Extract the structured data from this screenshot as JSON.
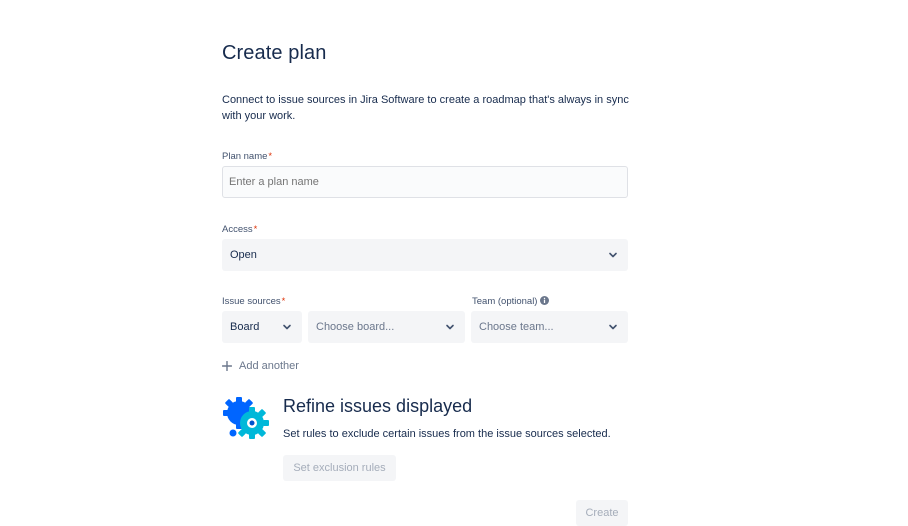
{
  "form": {
    "title": "Create plan",
    "description": "Connect to issue sources in Jira Software to create a roadmap that's always in sync with your work.",
    "plan_name": {
      "label": "Plan name",
      "required_mark": "*",
      "value": "",
      "placeholder": "Enter a plan name"
    },
    "access": {
      "label": "Access",
      "required_mark": "*",
      "value": "Open"
    },
    "issue_sources": {
      "label": "Issue sources",
      "required_mark": "*",
      "type_value": "Board",
      "board_placeholder": "Choose board..."
    },
    "team": {
      "label": "Team (optional)",
      "placeholder": "Choose team...",
      "info_icon": "info-icon"
    },
    "add_another_label": "Add another",
    "refine": {
      "title": "Refine issues displayed",
      "description": "Set rules to exclude certain issues from the issue sources selected.",
      "button_label": "Set exclusion rules",
      "icon": "gear-icon"
    },
    "create_label": "Create"
  },
  "colors": {
    "text": "#172b4d",
    "required": "#de350b",
    "disabled_text": "#a5adba",
    "field_bg": "#f4f5f7",
    "brand_blue": "#0065ff",
    "brand_cyan": "#00b8d9"
  }
}
